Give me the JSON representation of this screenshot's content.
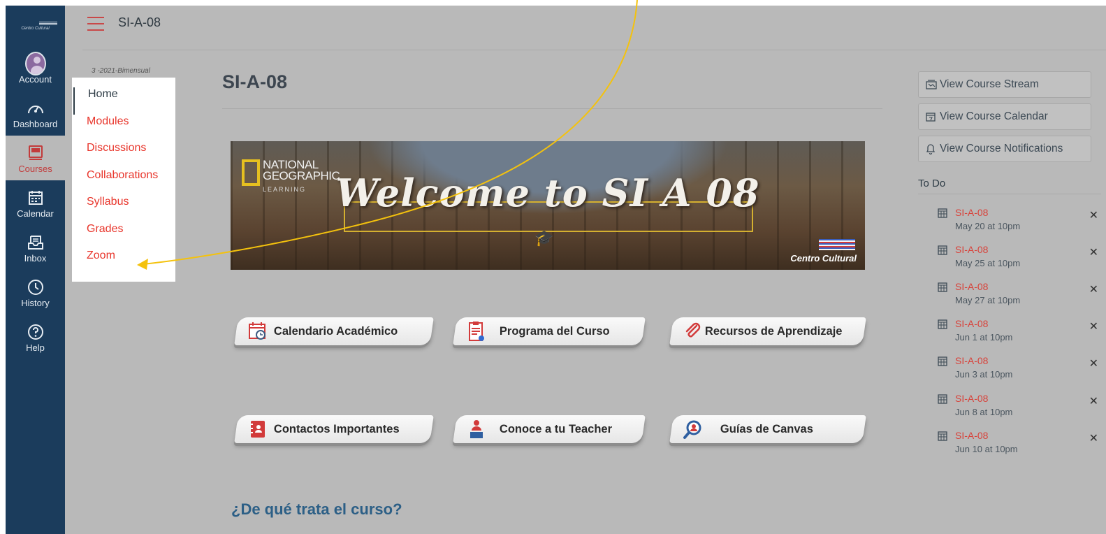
{
  "global_nav": {
    "logo_text": "Centro Cultural",
    "items": [
      {
        "label": "Account",
        "icon": "account-avatar-icon"
      },
      {
        "label": "Dashboard",
        "icon": "dashboard-icon"
      },
      {
        "label": "Courses",
        "icon": "courses-icon"
      },
      {
        "label": "Calendar",
        "icon": "calendar-icon"
      },
      {
        "label": "Inbox",
        "icon": "inbox-icon"
      },
      {
        "label": "History",
        "icon": "history-clock-icon"
      },
      {
        "label": "Help",
        "icon": "help-icon"
      }
    ],
    "active": "Courses"
  },
  "header": {
    "breadcrumb": "SI-A-08"
  },
  "course_nav": {
    "term": "3 -2021-Bimensual",
    "links": [
      "Home",
      "Modules",
      "Discussions",
      "Collaborations",
      "Syllabus",
      "Grades",
      "Zoom"
    ],
    "current": "Home"
  },
  "main": {
    "title": "SI-A-08",
    "banner": {
      "ng_line1": "NATIONAL",
      "ng_line2": "GEOGRAPHIC",
      "ng_sub": "LEARNING",
      "welcome": "Welcome to SI A 08",
      "brand": "Centro Cultural"
    },
    "buttons": [
      {
        "label": "Calendario Académico",
        "icon": "calendar-clock-icon"
      },
      {
        "label": "Programa del Curso",
        "icon": "clipboard-icon"
      },
      {
        "label": "Recursos de Aprendizaje",
        "icon": "paperclip-icon"
      },
      {
        "label": "Contactos Importantes",
        "icon": "contacts-book-icon"
      },
      {
        "label": "Conoce a tu Teacher",
        "icon": "teacher-icon"
      },
      {
        "label": "Guías de Canvas",
        "icon": "search-person-icon"
      }
    ],
    "section_heading": "¿De qué trata el curso?"
  },
  "sidebar_right": {
    "buttons": [
      {
        "label": "View Course Stream",
        "icon": "stream-icon"
      },
      {
        "label": "View Course Calendar",
        "icon": "calendar-icon"
      },
      {
        "label": "View Course Notifications",
        "icon": "bell-icon"
      }
    ],
    "todo_heading": "To Do",
    "todo": [
      {
        "name": "SI-A-08",
        "date": "May 20 at 10pm"
      },
      {
        "name": "SI-A-08",
        "date": "May 25 at 10pm"
      },
      {
        "name": "SI-A-08",
        "date": "May 27 at 10pm"
      },
      {
        "name": "SI-A-08",
        "date": "Jun 1 at 10pm"
      },
      {
        "name": "SI-A-08",
        "date": "Jun 3 at 10pm"
      },
      {
        "name": "SI-A-08",
        "date": "Jun 8 at 10pm"
      },
      {
        "name": "SI-A-08",
        "date": "Jun 10 at 10pm"
      }
    ],
    "dismiss_symbol": "✕"
  },
  "colors": {
    "nav_bg": "#1b3c5c",
    "link_red": "#e8352b",
    "annotation_arrow": "#f4c20d"
  }
}
